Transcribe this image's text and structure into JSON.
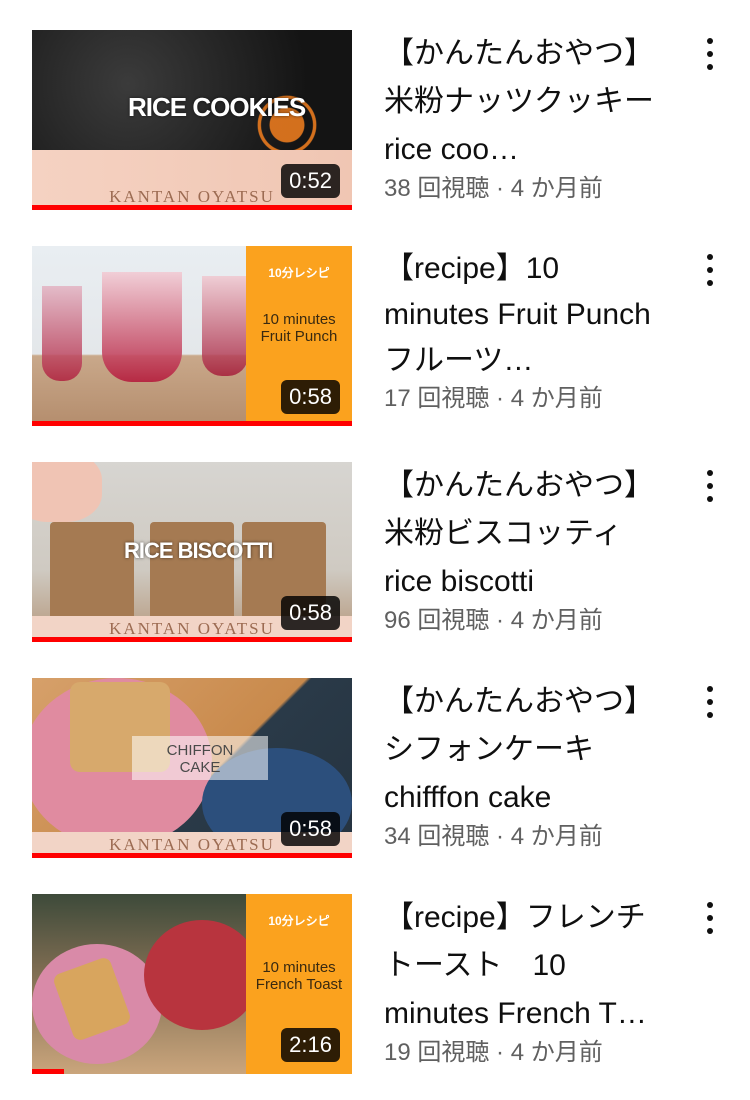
{
  "colors": {
    "accent_progress": "#ff0000",
    "panel_orange": "#fba21e"
  },
  "videos": [
    {
      "title": "【かんたんおやつ】米粉ナッツクッキー　rice coo…",
      "meta": "38 回視聴 · 4 か月前",
      "duration": "0:52",
      "watch_progress": 1.0,
      "thumb": {
        "headline": "RICE COOKIES",
        "brand": "KANTAN OYATSU"
      }
    },
    {
      "title": "【recipe】10 minutes Fruit Punch フルーツ…",
      "meta": "17 回視聴 · 4 か月前",
      "duration": "0:58",
      "watch_progress": 1.0,
      "thumb": {
        "tag": "10分レシピ",
        "text": "10 minutes\nFruit Punch"
      }
    },
    {
      "title": "【かんたんおやつ】米粉ビスコッティ　rice biscotti",
      "meta": "96 回視聴 · 4 か月前",
      "duration": "0:58",
      "watch_progress": 1.0,
      "thumb": {
        "headline": "RICE BISCOTTI",
        "brand": "KANTAN OYATSU"
      }
    },
    {
      "title": "【かんたんおやつ】シフォンケーキ chifffon cake",
      "meta": "34 回視聴 · 4 か月前",
      "duration": "0:58",
      "watch_progress": 1.0,
      "thumb": {
        "headline": "CHIFFON\nCAKE",
        "brand": "KANTAN OYATSU"
      }
    },
    {
      "title": "【recipe】フレンチトースト　10 minutes French T…",
      "meta": "19 回視聴 · 4 か月前",
      "duration": "2:16",
      "watch_progress": 0.1,
      "thumb": {
        "tag": "10分レシピ",
        "text": "10 minutes\nFrench Toast"
      }
    }
  ]
}
